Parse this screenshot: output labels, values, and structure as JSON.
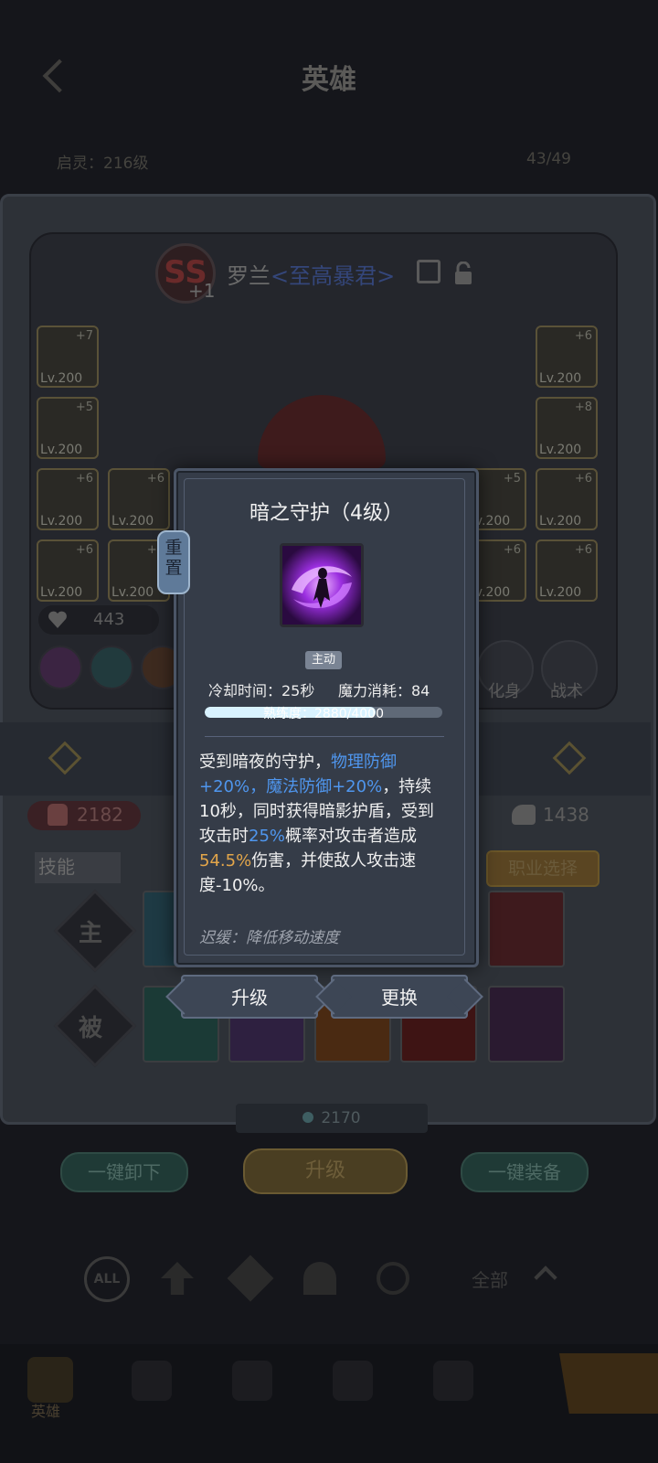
{
  "header": {
    "title": "英雄",
    "left_info": "启灵：216级",
    "right_info": "43/49"
  },
  "hero": {
    "rank": "SS",
    "rank_plus": "+1",
    "name": "罗兰",
    "title": "<至高暴君>"
  },
  "equipment_left": [
    {
      "lv": "Lv.200",
      "plus": "+7"
    },
    {
      "lv": "Lv.200",
      "plus": "+5"
    },
    {
      "lv": "Lv.200",
      "plus": "+6"
    },
    {
      "lv": "Lv.200",
      "plus": "+6"
    },
    {
      "lv": "Lv.200",
      "plus": "+6"
    },
    {
      "lv": "Lv.200",
      "plus": "+6"
    }
  ],
  "equipment_right": [
    {
      "lv": "Lv.200",
      "plus": "+6"
    },
    {
      "lv": "Lv.200",
      "plus": "+8"
    },
    {
      "lv": "Lv.200",
      "plus": "+5"
    },
    {
      "lv": "Lv.200",
      "plus": "+6"
    },
    {
      "lv": "Lv.200",
      "plus": "+6"
    },
    {
      "lv": "Lv.200",
      "plus": "+6"
    }
  ],
  "power_value": "443",
  "right_actions": {
    "transform": "化身",
    "tactics": "战术"
  },
  "stats": {
    "left_value": "2182",
    "right_value": "1438"
  },
  "skills_section": {
    "tab": "技能",
    "career_button": "职业选择",
    "active_label": "主",
    "passive_label": "被"
  },
  "bottom": {
    "currency_value": "2170",
    "unequip_all": "一键卸下",
    "upgrade": "升级",
    "equip_all": "一键装备",
    "filter_all": "ALL",
    "filter_label": "全部"
  },
  "bottom_tabs": [
    "英雄",
    "",
    "",
    "",
    ""
  ],
  "modal": {
    "title": "暗之守护（4级）",
    "reset_label": "重置",
    "type_badge": "主动",
    "cooldown": "冷却时间：25秒",
    "mana_cost": "魔力消耗：84",
    "proficiency_text": "熟练度：2880/4000",
    "proficiency_fraction": 0.72,
    "desc_p1": "受到暗夜的守护，",
    "desc_blue1": "物理防御+20%，魔法防御+20%",
    "desc_p2": "，持续10秒，同时获得暗影护盾，受到攻击时",
    "desc_blue2": "25%",
    "desc_p3": "概率对攻击者造成",
    "desc_orange": "54.5%",
    "desc_p4": "伤害，并使敌人攻击速度-10%。",
    "slow_note": "迟缓：降低移动速度",
    "upgrade_button": "升级",
    "replace_button": "更换"
  },
  "colors": {
    "modal_bg": "#353c48",
    "highlight_blue": "#4f96ee",
    "highlight_orange": "#e3a64a",
    "progress_fill": "#d8f2ff"
  }
}
